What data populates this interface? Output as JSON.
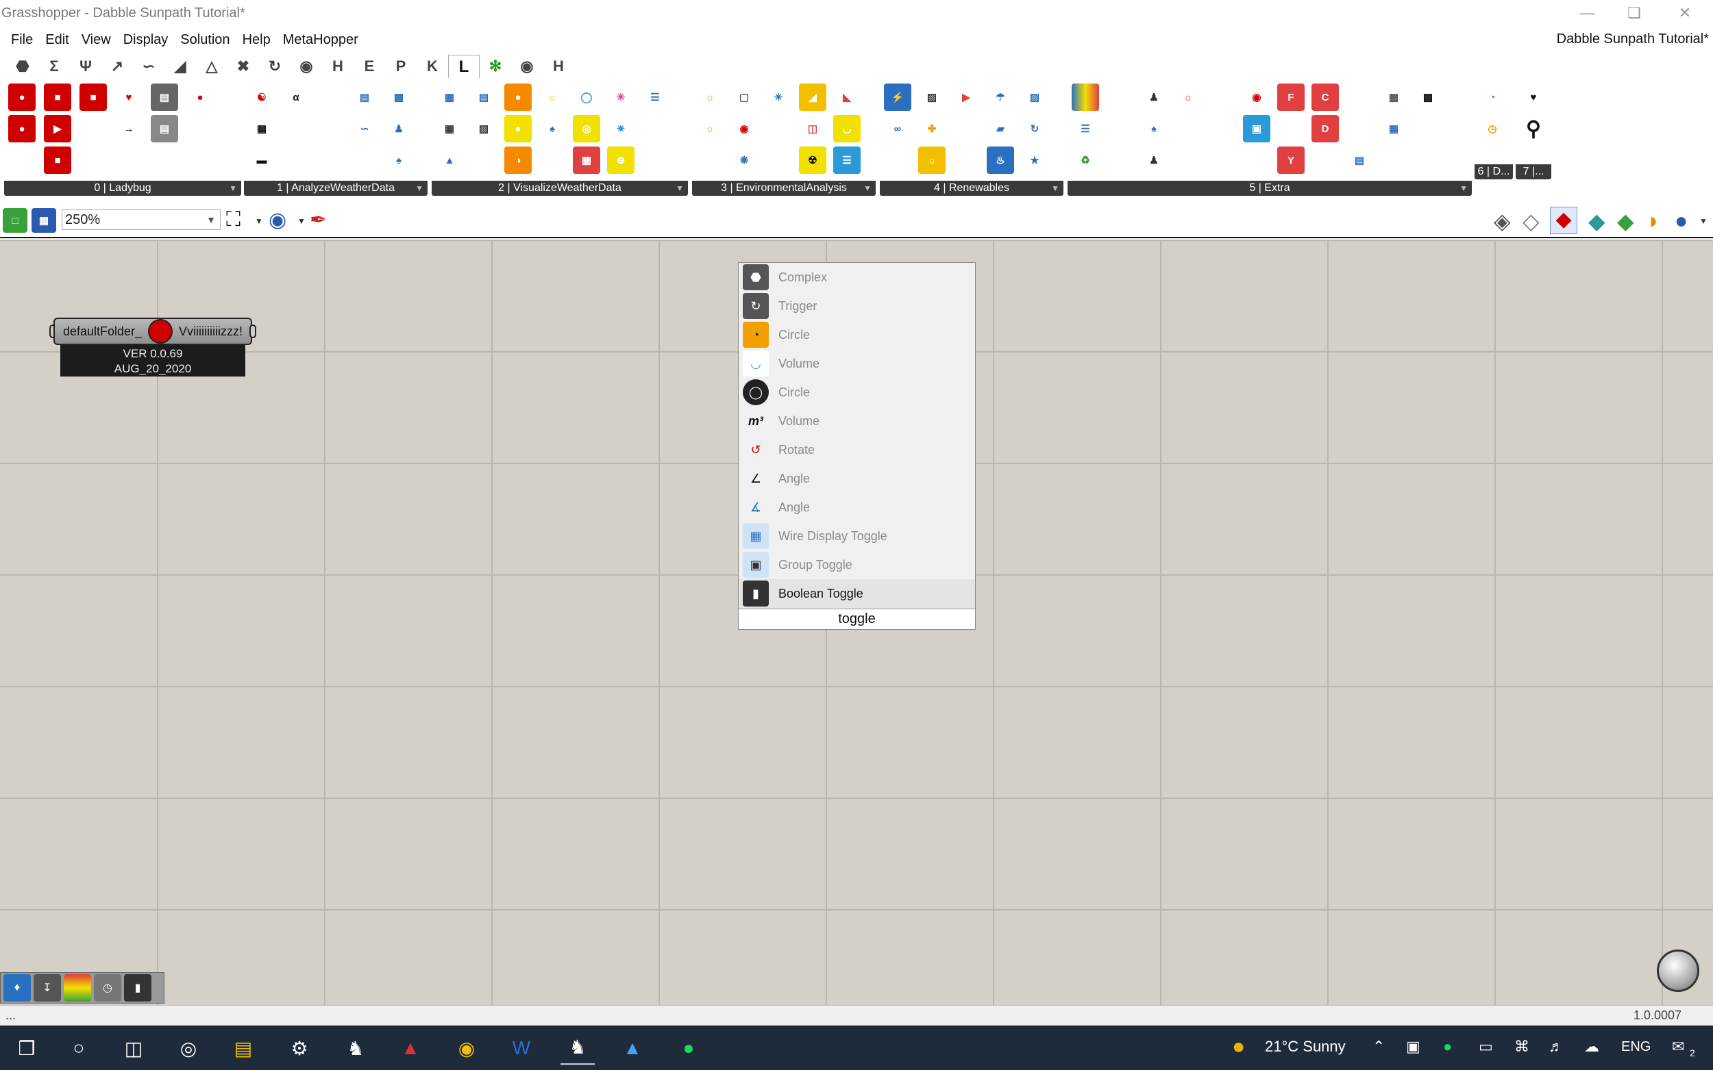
{
  "window": {
    "title": "Grasshopper - Dabble Sunpath Tutorial*",
    "document_name": "Dabble Sunpath Tutorial*"
  },
  "menu": [
    "File",
    "Edit",
    "View",
    "Display",
    "Solution",
    "Help",
    "MetaHopper"
  ],
  "tabs": [
    "H",
    "E",
    "P",
    "K",
    "L",
    "H"
  ],
  "active_tab": "L",
  "panels": [
    {
      "label": "0 | Ladybug"
    },
    {
      "label": "1 | AnalyzeWeatherData"
    },
    {
      "label": "2 | VisualizeWeatherData"
    },
    {
      "label": "3 | EnvironmentalAnalysis"
    },
    {
      "label": "4 | Renewables"
    },
    {
      "label": "5 | Extra"
    },
    {
      "label": "6 | D..."
    },
    {
      "label": "7 |..."
    }
  ],
  "toolbar": {
    "zoom": "250%"
  },
  "component": {
    "input": "defaultFolder_",
    "output": "Vviiiiiiiiiizzz!",
    "version": "VER 0.0.69",
    "date": "AUG_20_2020"
  },
  "search_popup": {
    "results": [
      {
        "label": "Complex",
        "icon": "complex-icon"
      },
      {
        "label": "Trigger",
        "icon": "trigger-icon"
      },
      {
        "label": "Circle",
        "icon": "circle-icon"
      },
      {
        "label": "Volume",
        "icon": "volume-icon"
      },
      {
        "label": "Circle",
        "icon": "circle-icon"
      },
      {
        "label": "Volume",
        "icon": "volume-m3-icon"
      },
      {
        "label": "Rotate",
        "icon": "rotate-icon"
      },
      {
        "label": "Angle",
        "icon": "angle-icon"
      },
      {
        "label": "Angle",
        "icon": "angle-icon"
      },
      {
        "label": "Wire Display Toggle",
        "icon": "wire-display-icon"
      },
      {
        "label": "Group Toggle",
        "icon": "group-toggle-icon"
      },
      {
        "label": "Boolean Toggle",
        "icon": "boolean-toggle-icon"
      }
    ],
    "selected_index": 11,
    "query": "toggle"
  },
  "status": {
    "left": "...",
    "version": "1.0.0007"
  },
  "taskbar": {
    "weather": "21°C  Sunny",
    "language": "ENG",
    "notifications": "2"
  }
}
